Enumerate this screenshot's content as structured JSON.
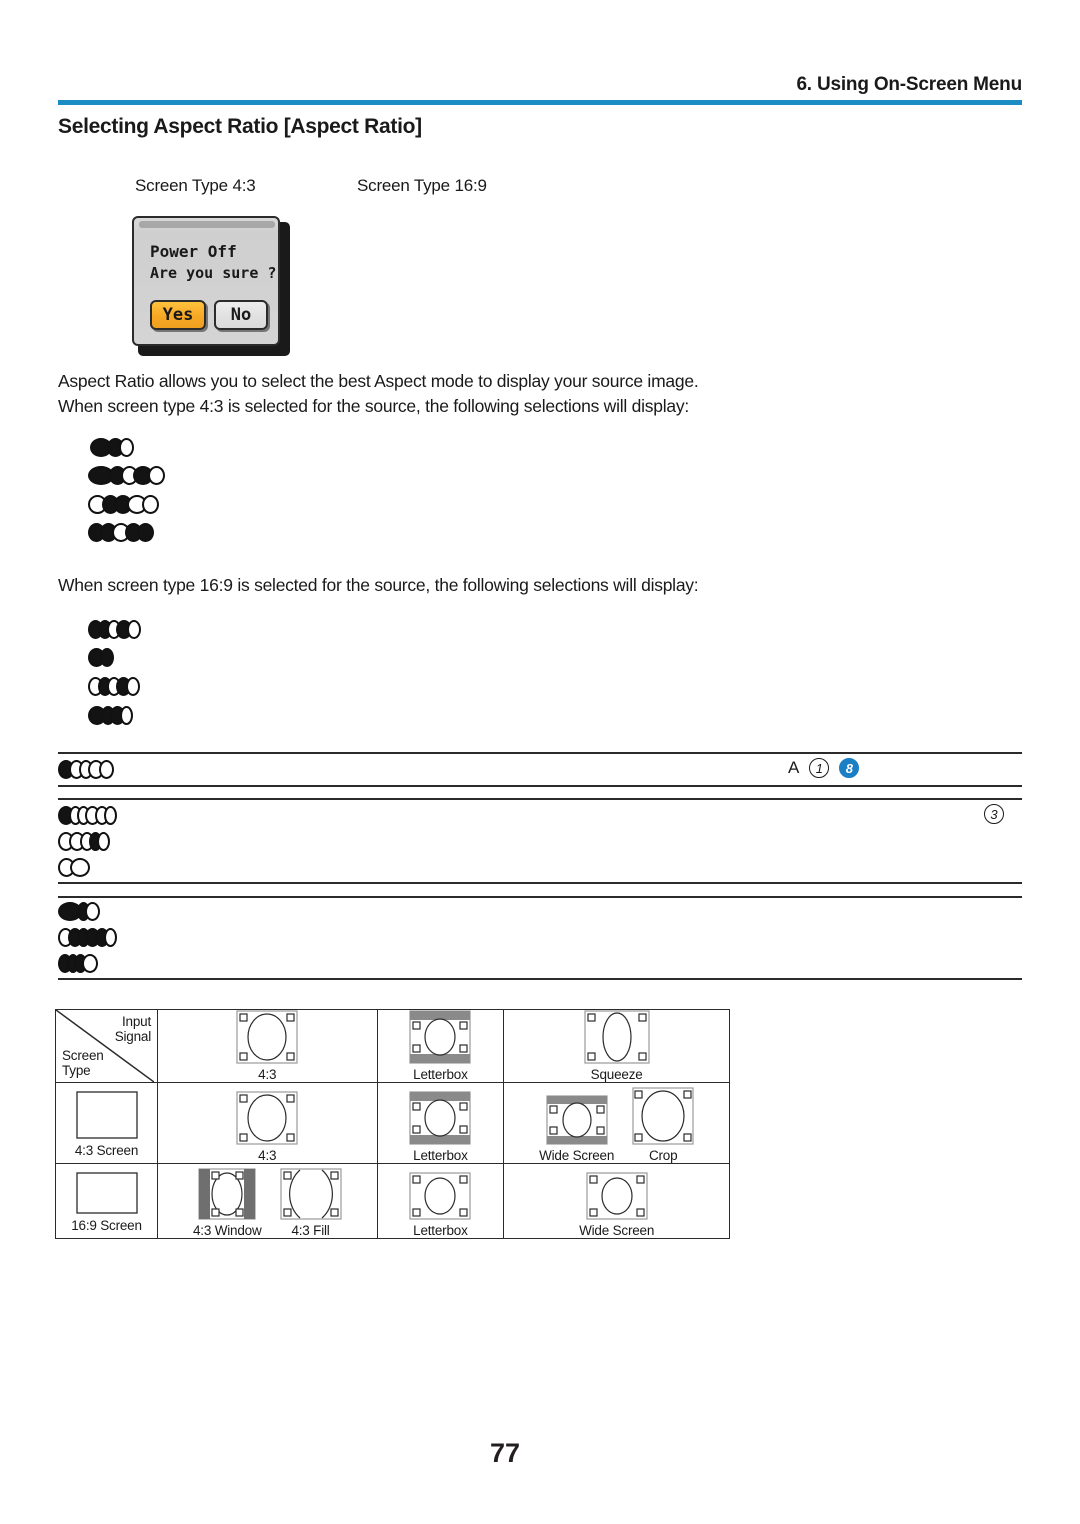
{
  "header": {
    "chapter": "6. Using On-Screen Menu",
    "rule_color": "#1b8cc4"
  },
  "section": {
    "title": "Selecting Aspect Ratio [Aspect Ratio]"
  },
  "captions": {
    "screen_type_43": "Screen Type 4:3",
    "screen_type_169": "Screen Type 16:9"
  },
  "osd_dialog": {
    "line1": "Power Off",
    "line2": "Are you sure ?",
    "yes_label": "Yes",
    "no_label": "No",
    "yes_color": "#f5a623"
  },
  "body": {
    "para1": "Aspect Ratio allows you to select the best Aspect mode to display your source image.",
    "para2": "When screen type 4:3 is selected for the source, the following selections will display:",
    "para3": "When screen type 16:9 is selected for the source, the following selections will display:"
  },
  "markers": {
    "letter_a": "A",
    "circled_1": "1",
    "circled_8": "8",
    "circled_3": "3",
    "circled_8_color": "#1b7fc4"
  },
  "comparison_table": {
    "header": {
      "input_signal_line1": "Input",
      "input_signal_line2": "Signal",
      "screen_type_line1": "Screen",
      "screen_type_line2": "Type"
    },
    "header_cells": [
      {
        "caption": "4:3",
        "thumb": "oval-4x3"
      },
      {
        "caption": "Letterbox",
        "thumb": "oval-letterbox"
      },
      {
        "caption": "Squeeze",
        "thumb": "oval-squeeze"
      }
    ],
    "rows": [
      {
        "type_label": "4:3 Screen",
        "type_thumb": "blank-4x3",
        "cells": [
          {
            "items": [
              {
                "caption": "4:3",
                "thumb": "oval-4x3"
              }
            ]
          },
          {
            "items": [
              {
                "caption": "Letterbox",
                "thumb": "oval-letterbox"
              }
            ]
          },
          {
            "items": [
              {
                "caption": "Wide Screen",
                "thumb": "oval-letterbox"
              },
              {
                "caption": "Crop",
                "thumb": "oval-crop"
              }
            ]
          }
        ]
      },
      {
        "type_label": "16:9 Screen",
        "type_thumb": "blank-16x9",
        "cells": [
          {
            "items": [
              {
                "caption": "4:3 Window",
                "thumb": "oval-pillarbox"
              },
              {
                "caption": "4:3 Fill",
                "thumb": "oval-fill"
              }
            ]
          },
          {
            "items": [
              {
                "caption": "Letterbox",
                "thumb": "oval-wide"
              }
            ]
          },
          {
            "items": [
              {
                "caption": "Wide Screen",
                "thumb": "oval-wide"
              }
            ]
          }
        ]
      }
    ]
  },
  "footer": {
    "page_number": "77"
  }
}
